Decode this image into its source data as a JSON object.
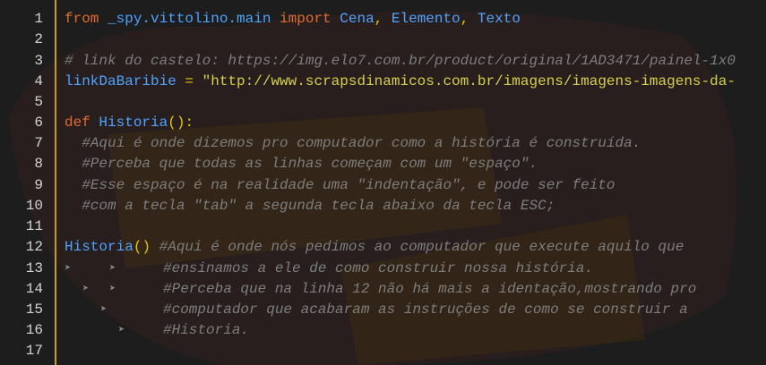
{
  "line_numbers": [
    "1",
    "2",
    "3",
    "4",
    "5",
    "6",
    "7",
    "8",
    "9",
    "10",
    "11",
    "12",
    "13",
    "14",
    "15",
    "16",
    "17"
  ],
  "code": {
    "l1": {
      "kw_from": "from",
      "module": " _spy.vittolino.main",
      "kw_import": " import",
      "cls1": " Cena",
      "sep1": ",",
      "cls2": " Elemento",
      "sep2": ",",
      "cls3": " Texto"
    },
    "l3": {
      "comment": "# link do castelo: https://img.elo7.com.br/product/original/1AD3471/painel-1x0"
    },
    "l4": {
      "var": "linkDaBaribie",
      "eq": " = ",
      "str": "\"http://www.scrapsdinamicos.com.br/imagens/imagens-imagens-da-"
    },
    "l6": {
      "kw_def": "def",
      "fn": " Historia",
      "parens": "():"
    },
    "l7": {
      "comment": "  #Aqui é onde dizemos pro computador como a história é construída."
    },
    "l8": {
      "comment": "  #Perceba que todas as linhas começam com um \"espaço\"."
    },
    "l9": {
      "comment": "  #Esse espaço é na realidade uma \"indentação\", e pode ser feito"
    },
    "l10": {
      "comment": "  #com a tecla \"tab\" a segunda tecla abaixo da tecla ESC;"
    },
    "l12": {
      "fn": "Historia",
      "parens": "()",
      "comment": " #Aqui é onde nós pedimos ao computador que execute aquilo que"
    },
    "l13": {
      "comment": "#ensinamos a ele de como construir nossa história."
    },
    "l14": {
      "comment": "#Perceba que na linha 12 não há mais a identação,mostrando pro"
    },
    "l15": {
      "comment": "#computador que acabaram as instruções de como se construir a"
    },
    "l16": {
      "comment": "#Historia."
    }
  },
  "tab_marker": "➤",
  "colors": {
    "keyword": "#e06c2e",
    "identifier": "#4fa3ff",
    "string": "#d6d04a",
    "comment": "#7e7e7e",
    "ruler": "#c9a100",
    "background": "#1d1d1d"
  }
}
